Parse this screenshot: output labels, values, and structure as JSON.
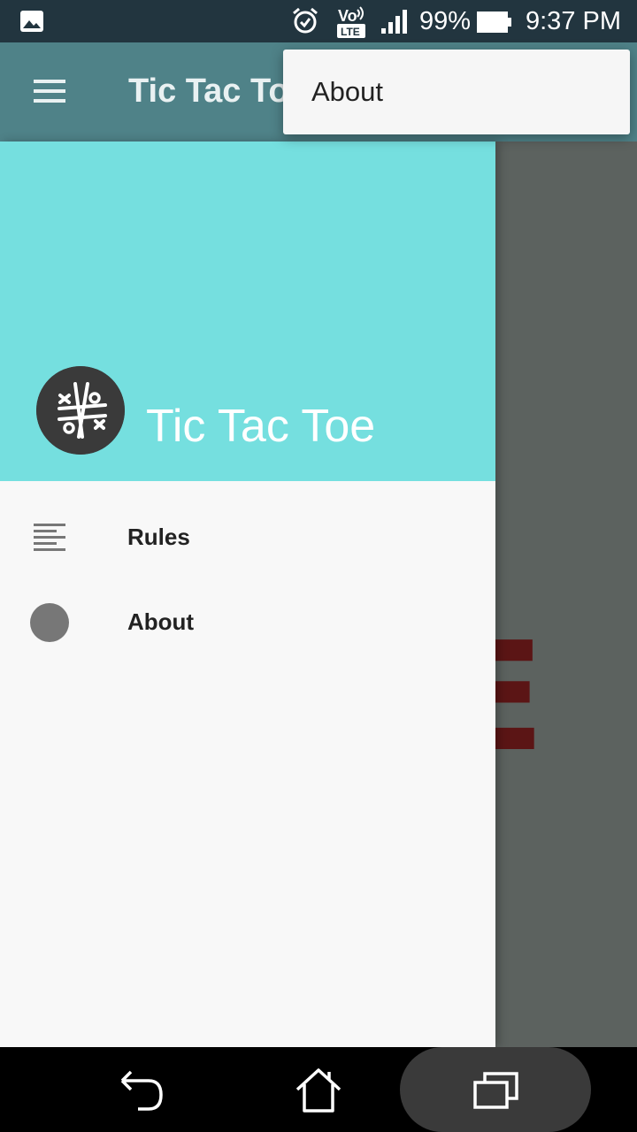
{
  "status_bar": {
    "battery_percent": "99%",
    "time": "9:37 PM",
    "icons": [
      "gallery-icon",
      "alarm-icon",
      "volte-icon",
      "signal-icon",
      "battery-icon"
    ],
    "volte_top": "Vo",
    "volte_bottom": "LTE"
  },
  "app_bar": {
    "title": "Tic Tac Toe",
    "menu_icon": "hamburger-menu-icon"
  },
  "popup_menu": {
    "items": [
      {
        "label": "About"
      }
    ]
  },
  "drawer": {
    "header_title": "Tic Tac Toe",
    "header_color": "#75dfdf",
    "logo_icon": "tic-tac-toe-logo-icon",
    "items": [
      {
        "label": "Rules",
        "icon": "text-lines-icon"
      },
      {
        "label": "About",
        "icon": "circle-icon"
      }
    ]
  },
  "background": {
    "partial_letter": "E",
    "scrim_color": "#5c625f"
  },
  "system_nav": {
    "buttons": [
      "back-button",
      "home-button",
      "recents-button"
    ]
  }
}
